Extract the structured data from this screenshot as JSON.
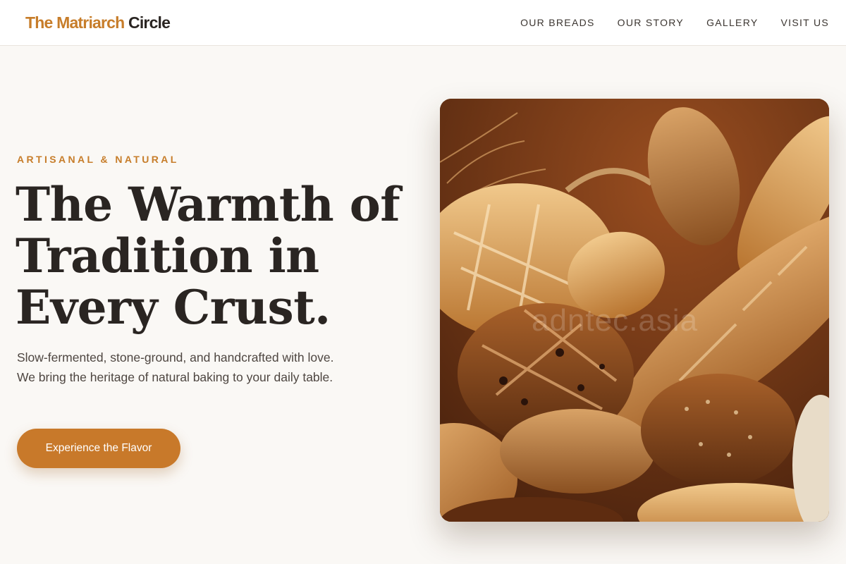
{
  "brand": {
    "name_part1": "The Matriarch",
    "name_part2": "Circle"
  },
  "nav": {
    "items": [
      {
        "label": "OUR BREADS"
      },
      {
        "label": "OUR STORY"
      },
      {
        "label": "GALLERY"
      },
      {
        "label": "VISIT US"
      }
    ]
  },
  "hero": {
    "eyebrow": "ARTISANAL & NATURAL",
    "headline_line1": "The Warmth of",
    "headline_line2": "Tradition in",
    "headline_line3": "Every Crust.",
    "subtext": "Slow-fermented, stone-ground, and handcrafted with love. We bring the heritage of natural baking to your daily table.",
    "cta_label": "Experience the Flavor",
    "image_watermark": "adntec.asia"
  },
  "colors": {
    "accent": "#c8792a",
    "text_dark": "#2a2522",
    "background": "#faf8f5"
  }
}
